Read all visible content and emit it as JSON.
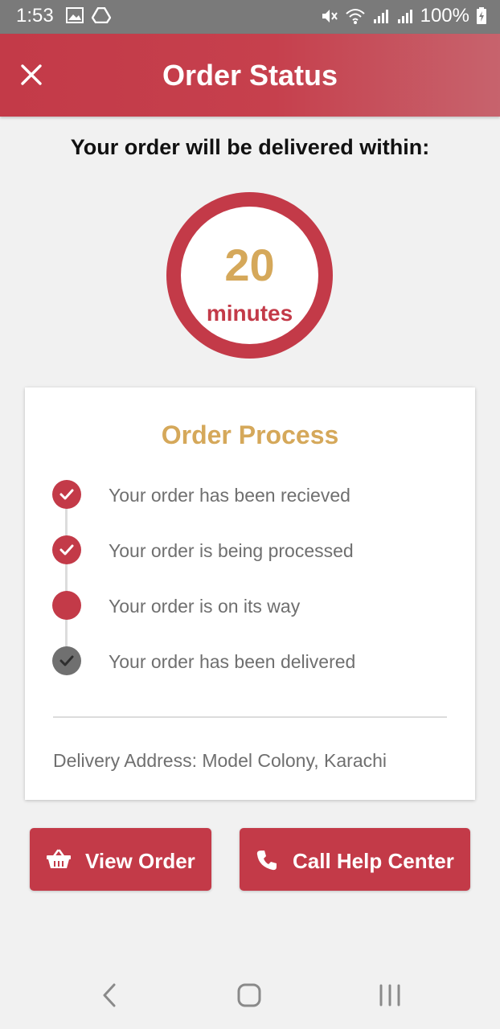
{
  "status_bar": {
    "time": "1:53",
    "battery": "100%",
    "icons": [
      "gallery-icon",
      "drive-icon",
      "mute-icon",
      "wifi-icon",
      "signal-icon",
      "signal-icon",
      "battery-charging-icon"
    ]
  },
  "app_bar": {
    "title": "Order Status",
    "close_icon": "close-icon"
  },
  "delivery": {
    "headline": "Your order will be delivered within:",
    "time_value": "20",
    "time_unit": "minutes"
  },
  "order_process": {
    "title": "Order Process",
    "steps": [
      {
        "label": "Your order has been recieved",
        "state": "complete",
        "icon": "check-icon"
      },
      {
        "label": "Your order is being processed",
        "state": "complete",
        "icon": "check-icon"
      },
      {
        "label": "Your order is on its way",
        "state": "current",
        "icon": "none"
      },
      {
        "label": "Your order has been delivered",
        "state": "pending",
        "icon": "check-icon"
      }
    ],
    "address": "Delivery Address: Model Colony, Karachi"
  },
  "actions": {
    "view_order": {
      "label": "View Order",
      "icon": "basket-icon"
    },
    "call_help": {
      "label": "Call Help Center",
      "icon": "phone-icon"
    }
  },
  "nav": {
    "back_icon": "back-icon",
    "home_icon": "home-icon",
    "recents_icon": "recents-icon"
  },
  "colors": {
    "primary": "#c33a48",
    "accent_gold": "#d5a85a",
    "pending_grey": "#707070",
    "background": "#f1f1f1"
  }
}
